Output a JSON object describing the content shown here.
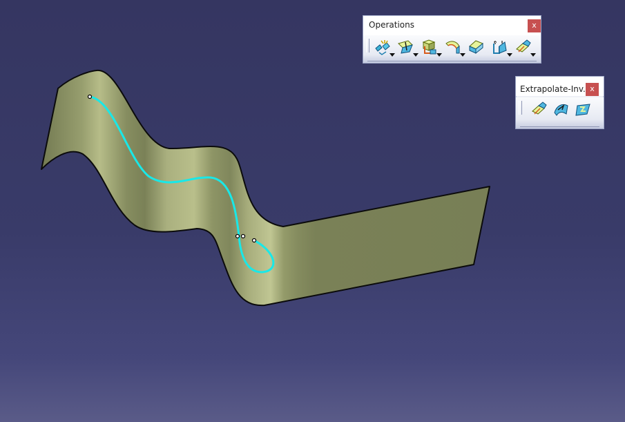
{
  "operations_toolbar": {
    "title": "Operations",
    "close_label": "x",
    "tools": [
      {
        "icon": "join-icon",
        "has_dropdown": true
      },
      {
        "icon": "split-icon",
        "has_dropdown": true
      },
      {
        "icon": "extract-icon",
        "has_dropdown": true
      },
      {
        "icon": "shape-fillet-icon",
        "has_dropdown": true
      },
      {
        "icon": "translate-icon",
        "has_dropdown": false
      },
      {
        "icon": "scaling-icon",
        "has_dropdown": true
      },
      {
        "icon": "extrapolate-icon",
        "has_dropdown": true
      }
    ]
  },
  "extrapolate_toolbar": {
    "title": "Extrapolate-Inv...",
    "close_label": "x",
    "tools": [
      {
        "icon": "extrapolate-icon"
      },
      {
        "icon": "invert-orientation-icon"
      },
      {
        "icon": "near-icon"
      }
    ]
  },
  "colors": {
    "surface": "#79805a",
    "surface_highlight": "#c4c996",
    "curve": "#19e8e8",
    "background_top": "#353661",
    "background_bottom": "#5a5b88"
  }
}
